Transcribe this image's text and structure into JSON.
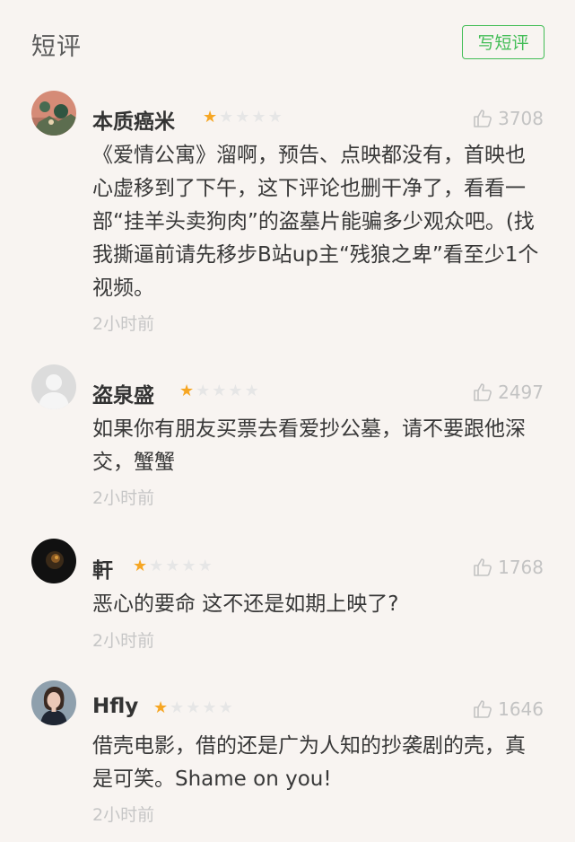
{
  "header": {
    "title": "短评",
    "write_button": "写短评"
  },
  "colors": {
    "accent": "#42bd56",
    "star_on": "#f6a623",
    "star_off": "#e6e6e6",
    "background": "#f8f4f1"
  },
  "reviews": [
    {
      "username": "本质癌米",
      "rating": 1,
      "rating_max": 5,
      "likes": "3708",
      "content": "《爱情公寓》溜啊，预告、点映都没有，首映也心虚移到了下午，这下评论也删干净了，看看一部“挂羊头卖狗肉”的盗墓片能骗多少观众吧。(找我撕逼前请先移步B站up主“残狼之卑”看至少1个视频。",
      "time": "2小时前",
      "avatar": "landscape-avatar"
    },
    {
      "username": "盗泉盛",
      "rating": 1,
      "rating_max": 5,
      "likes": "2497",
      "content": "如果你有朋友买票去看爱抄公墓，请不要跟他深交，蟹蟹",
      "time": "2小时前",
      "avatar": "default-user-avatar"
    },
    {
      "username": "軒",
      "rating": 1,
      "rating_max": 5,
      "likes": "1768",
      "content": "恶心的要命 这不还是如期上映了?",
      "time": "2小时前",
      "avatar": "dark-photo-avatar"
    },
    {
      "username": "Hfly",
      "rating": 1,
      "rating_max": 5,
      "likes": "1646",
      "content": "借壳电影，借的还是广为人知的抄袭剧的壳，真是可笑。Shame on you!",
      "time": "2小时前",
      "avatar": "portrait-avatar"
    }
  ]
}
